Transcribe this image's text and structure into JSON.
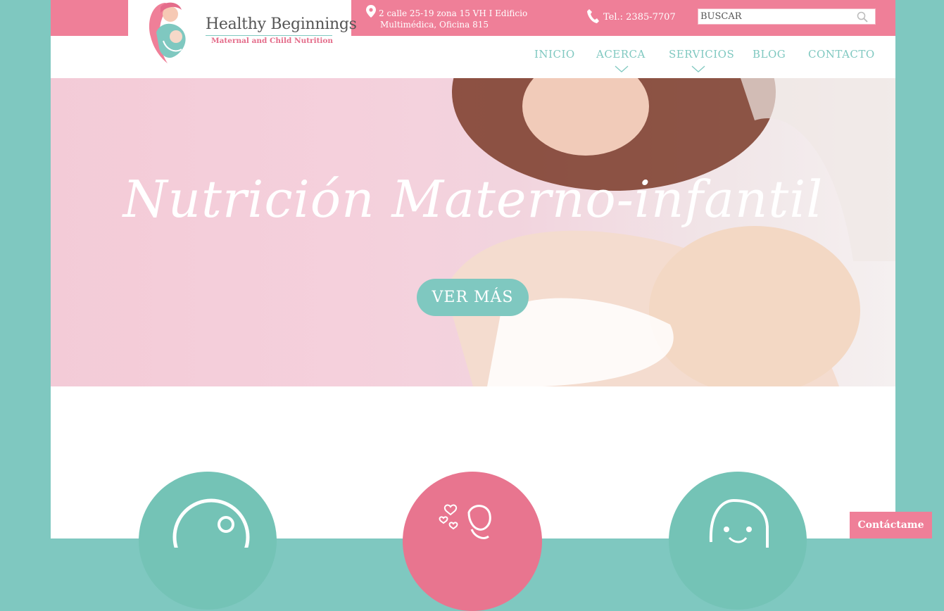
{
  "brand": {
    "name": "Healthy Beginnings",
    "tagline": "Maternal and Child Nutrition"
  },
  "contact": {
    "address_line1": "2 calle 25-19 zona 15 VH I Edificio",
    "address_line2": "Multimédica, Oficina 815",
    "phone": "Tel.: 2385-7707"
  },
  "search": {
    "placeholder": "BUSCAR"
  },
  "nav": {
    "items": [
      {
        "label": "INICIO"
      },
      {
        "label": "ACERCA"
      },
      {
        "label": "SERVICIOS"
      },
      {
        "label": "BLOG"
      },
      {
        "label": "CONTACTO"
      }
    ]
  },
  "hero": {
    "title": "Nutrición Materno-infantil",
    "button": "VER MÁS"
  },
  "floating": {
    "contact_label": "Contáctame"
  },
  "colors": {
    "pink": "#ef7f98",
    "teal": "#7fc8c0",
    "circle_teal": "#74c3b6",
    "circle_pink": "#e8758f"
  }
}
